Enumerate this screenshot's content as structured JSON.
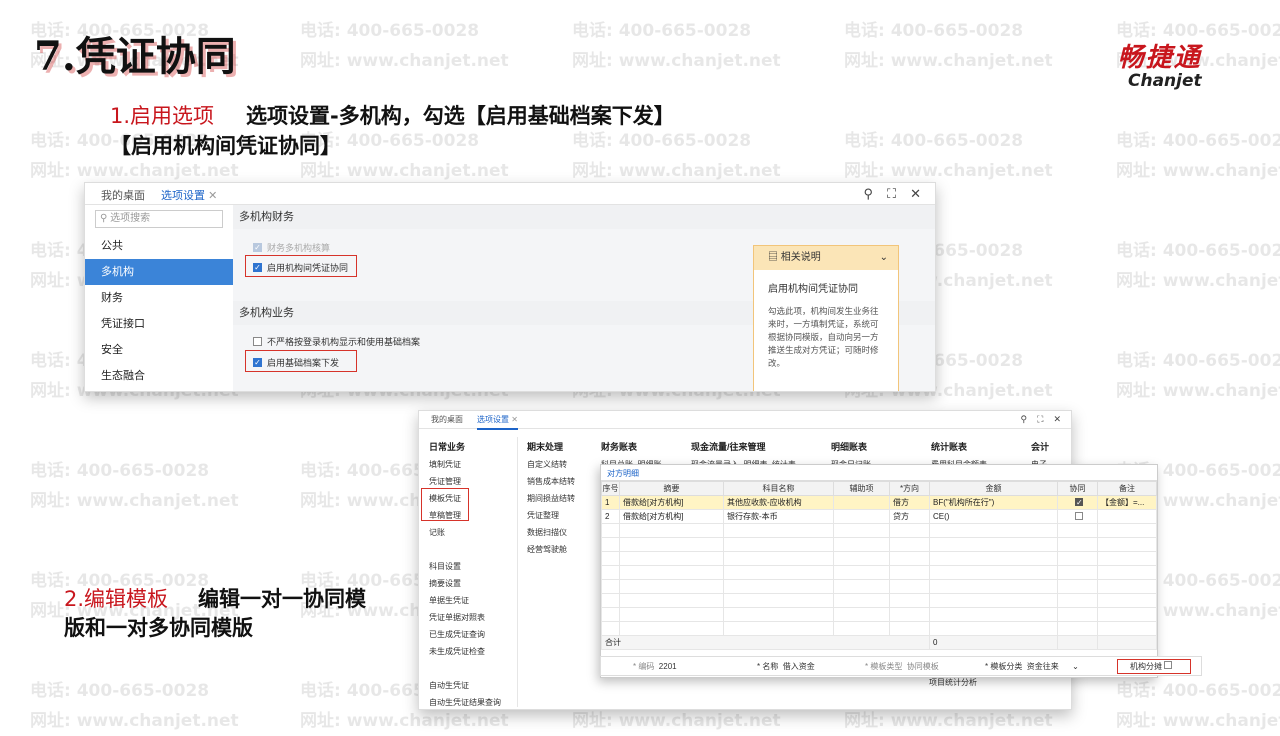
{
  "watermark": {
    "phone": "电话: 400-665-0028",
    "site": "网址: www.chanjet.net"
  },
  "slide": {
    "title_num": "7.",
    "title_text": "凭证协同",
    "logo_cn": "畅捷通",
    "logo_en": "Chanjet",
    "step1_label": "1.启用选项",
    "step1_text": "选项设置-多机构，勾选【启用基础档案下发】",
    "step1_text2": "【启用机构间凭证协同】",
    "step2_label": "2.编辑模板",
    "step2_text": "编辑一对一协同模",
    "step2_text2": "版和一对多协同模版"
  },
  "win1": {
    "tabs": [
      "我的桌面",
      "选项设置"
    ],
    "search_placeholder": "选项搜索",
    "sidebar": [
      "公共",
      "多机构",
      "财务",
      "凭证接口",
      "安全",
      "生态融合"
    ],
    "section1": "多机构财务",
    "opt1": "财务多机构核算",
    "opt2": "启用机构间凭证协同",
    "section2": "多机构业务",
    "opt3": "不严格按登录机构显示和使用基础档案",
    "opt4": "启用基础档案下发",
    "note_head": "相关说明",
    "note_title": "启用机构间凭证协同",
    "note_body": "勾选此项，机构间发生业务往来时，一方填制凭证，系统可根据协同模版，自动向另一方推送生成对方凭证；可随时修改。"
  },
  "win2": {
    "tabs": [
      "我的桌面",
      "选项设置"
    ],
    "col1_head": "日常业务",
    "col1": [
      "填制凭证",
      "凭证管理",
      "模板凭证",
      "草稿管理",
      "记账",
      "",
      "科目设置",
      "摘要设置",
      "单据生凭证",
      "凭证单据对照表",
      "已生成凭证查询",
      "未生成凭证检查",
      "",
      "自动生凭证",
      "自动生凭证结果查询"
    ],
    "col2_head": "期末处理",
    "col2": [
      "自定义结转",
      "销售成本结转",
      "期间损益结转",
      "凭证整理",
      "数据扫描仪",
      "经营驾驶舱"
    ],
    "col3_head": "财务账表",
    "col3": [
      "科目总账",
      "明细账"
    ],
    "col4_head": "现金流量/往来管理",
    "col4": [
      "现金流量录入",
      "明细表",
      "统计表"
    ],
    "col5_head": "明细账表",
    "col5": [
      "现金日记账"
    ],
    "col6_head": "统计账表",
    "col6": [
      "费用科目余额表"
    ],
    "col7_head": "会计",
    "col7": [
      "电子"
    ],
    "extra": "项目统计分析"
  },
  "win3": {
    "tab": "对方明细",
    "headers": [
      "序号",
      "摘要",
      "科目名称",
      "辅助项",
      "*方向",
      "金额",
      "协同",
      "备注"
    ],
    "rows": [
      [
        "1",
        "借款给[对方机构]",
        "其他应收款-应收机构",
        "",
        "借方",
        "BF(\"机构所在行\")",
        "checked",
        "【金额】=..."
      ],
      [
        "2",
        "借款给[对方机构]",
        "银行存款-本币",
        "",
        "贷方",
        "CE()",
        "unchecked",
        ""
      ]
    ],
    "total_label": "合计",
    "total_value": "0"
  },
  "bottom": {
    "code_label": "* 编码",
    "code_value": "2201",
    "name_label": "* 名称",
    "name_value": "借入资金",
    "type_label": "* 模板类型",
    "type_value": "协同模板",
    "cat_label": "* 模板分类",
    "cat_value": "资金往来",
    "split_label": "机构分摊"
  }
}
